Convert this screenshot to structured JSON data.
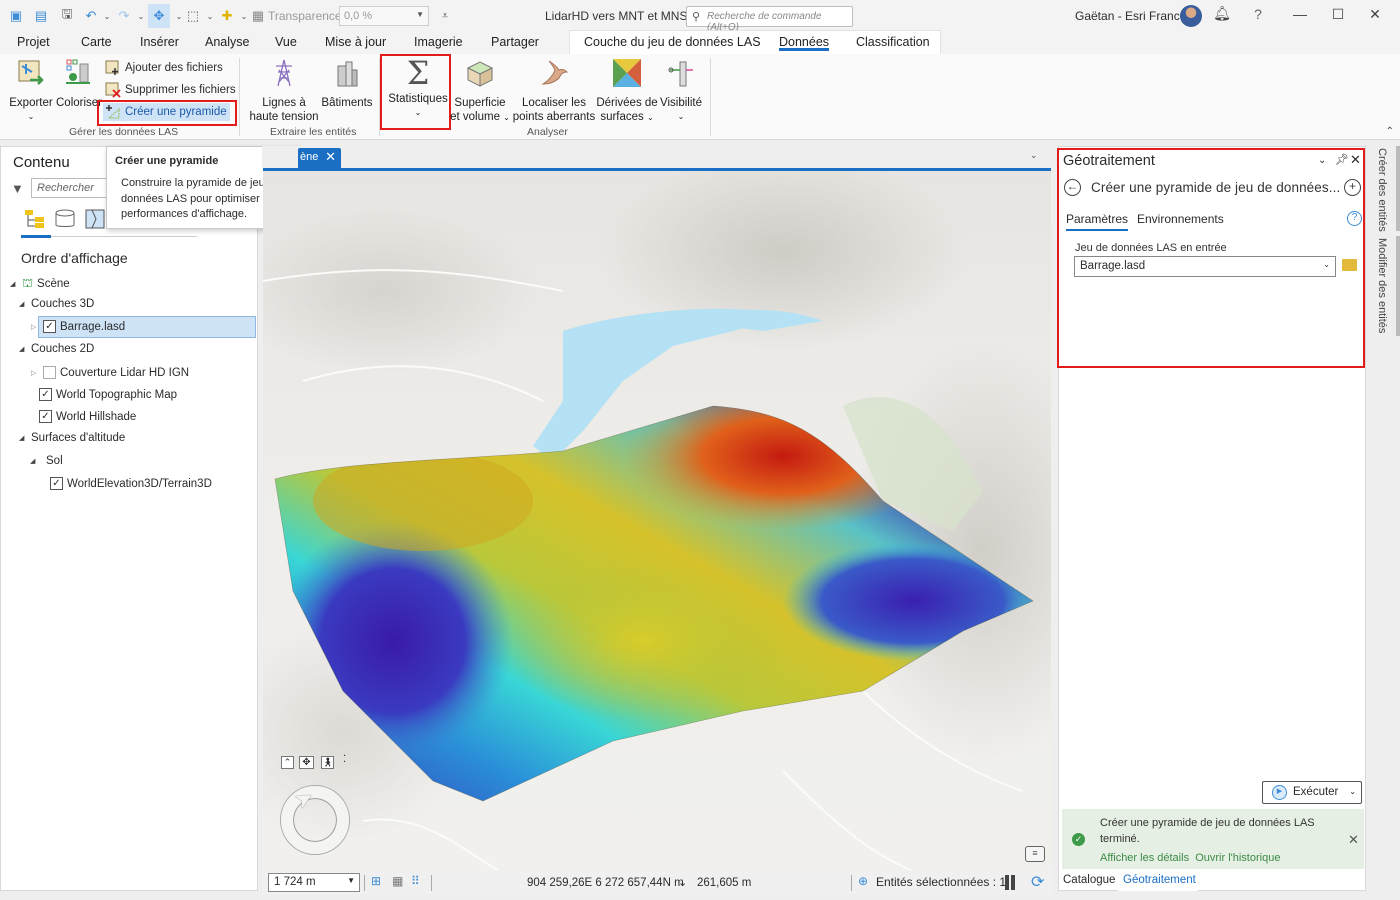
{
  "titlebar": {
    "transparency_label": "Transparence",
    "transparency_value": "0,0 %",
    "app_title": "LidarHD vers MNT et MNS",
    "command_search_placeholder": "Recherche de commande (Alt+Q)",
    "user_name": "Gaëtan - Esri France",
    "help_glyph": "?"
  },
  "ribbon_tabs": [
    "Projet",
    "Carte",
    "Insérer",
    "Analyse",
    "Vue",
    "Mise à jour",
    "Imagerie",
    "Partager"
  ],
  "contextual_tabs": {
    "items": [
      "Couche du jeu de données LAS",
      "Données",
      "Classification"
    ],
    "active": "Données"
  },
  "ribbon": {
    "groups": {
      "manage_las": {
        "label": "Gérer les données LAS",
        "export": "Exporter",
        "colorize": "Coloriser",
        "add_files": "Ajouter des fichiers",
        "remove_files": "Supprimer les fichiers",
        "build_pyramid": "Créer une pyramide"
      },
      "extract": {
        "label": "Extraire les entités",
        "power_lines": "Lignes à haute tension",
        "power_lines_l1": "Lignes à",
        "power_lines_l2": "haute tension",
        "buildings": "Bâtiments"
      },
      "analyze": {
        "label": "Analyser",
        "statistics": "Statistiques",
        "area_volume_l1": "Superficie",
        "area_volume_l2": "et volume",
        "outliers_l1": "Localiser les",
        "outliers_l2": "points aberrants",
        "surface_deriv_l1": "Dérivées de",
        "surface_deriv_l2": "surfaces",
        "visibility": "Visibilité"
      }
    }
  },
  "tooltip": {
    "title": "Créer une pyramide",
    "body": "Construire la pyramide de jeu de données LAS pour optimiser ses performances d'affichage."
  },
  "contents": {
    "title": "Contenu",
    "search_placeholder": "Rechercher",
    "drawing_order_title": "Ordre d'affichage",
    "tree": {
      "scene": "Scène",
      "layers3d": "Couches 3D",
      "barrage": {
        "label": "Barrage.lasd",
        "checked": true,
        "selected": true
      },
      "layers2d": "Couches 2D",
      "lidar_cover": {
        "label": "Couverture Lidar HD IGN",
        "checked": false
      },
      "topo": {
        "label": "World Topographic Map",
        "checked": true
      },
      "hillshade": {
        "label": "World Hillshade",
        "checked": true
      },
      "elevation_surfaces": "Surfaces d'altitude",
      "ground": "Sol",
      "terrain": {
        "label": "WorldElevation3D/Terrain3D",
        "checked": true
      }
    }
  },
  "map": {
    "tab_label": "ène",
    "scale": "1 724 m",
    "coordinates": "904 259,26E 6 272 657,44N m",
    "elevation": "261,605 m",
    "selected_features": "Entités sélectionnées : 1"
  },
  "geoprocessing": {
    "title": "Géotraitement",
    "tool_title": "Créer une pyramide de jeu de données...",
    "tabs": [
      "Paramètres",
      "Environnements"
    ],
    "active_tab": "Paramètres",
    "input_label": "Jeu de données LAS en entrée",
    "input_value": "Barrage.lasd",
    "run_label": "Exécuter",
    "message": "Créer une pyramide de jeu de données LAS terminé.",
    "link_details": "Afficher les détails",
    "link_history": "Ouvrir l'historique"
  },
  "bottom_tabs": [
    "Catalogue",
    "Géotraitement"
  ],
  "bottom_active": "Géotraitement",
  "side_tabs": [
    "Créer des entités",
    "Modifier des entités"
  ],
  "colors": {
    "accent": "#1a6fc4",
    "highlight_box": "#e31b1b",
    "success": "#3c9a48",
    "message_bg": "#e6efe3"
  }
}
